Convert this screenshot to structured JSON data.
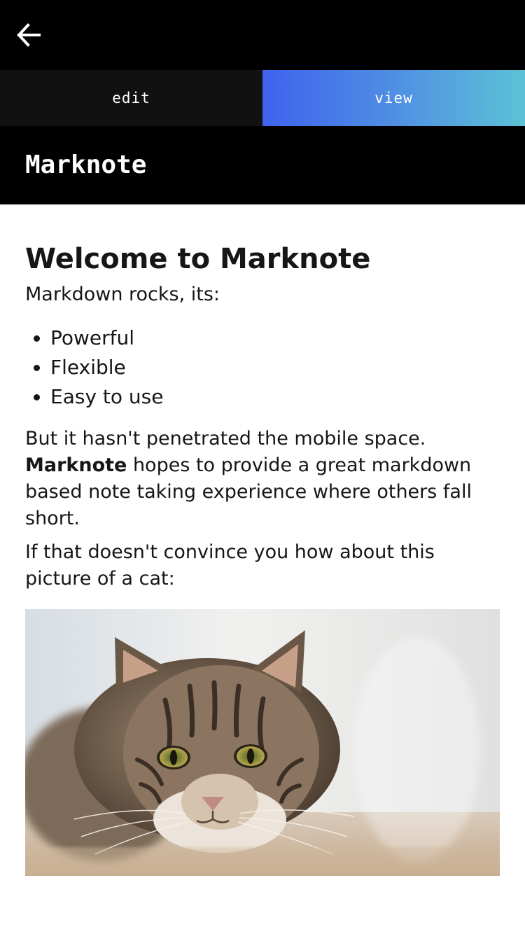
{
  "topbar": {
    "back_icon": "arrow-left-icon"
  },
  "tabs": [
    {
      "label": "edit",
      "active": false
    },
    {
      "label": "view",
      "active": true
    }
  ],
  "colors": {
    "view_tab_gradient": [
      "#4063ee",
      "#5dc2d6"
    ],
    "bar_background": "#000000",
    "edit_tab_background": "#111111"
  },
  "app": {
    "title": "Marknote"
  },
  "note": {
    "heading": "Welcome to Marknote",
    "intro": "Markdown rocks, its:",
    "features": [
      "Powerful",
      "Flexible",
      "Easy to use"
    ],
    "para2_bold": "Marknote",
    "para2_line1": "But it hasn't penetrated the mobile space.",
    "para2_rest": " hopes to provide a great markdown based note taking experience where others fall short.",
    "para3": "If that doesn't convince you how about this picture of a cat:"
  },
  "image": {
    "subject": "tabby cat lying down"
  }
}
